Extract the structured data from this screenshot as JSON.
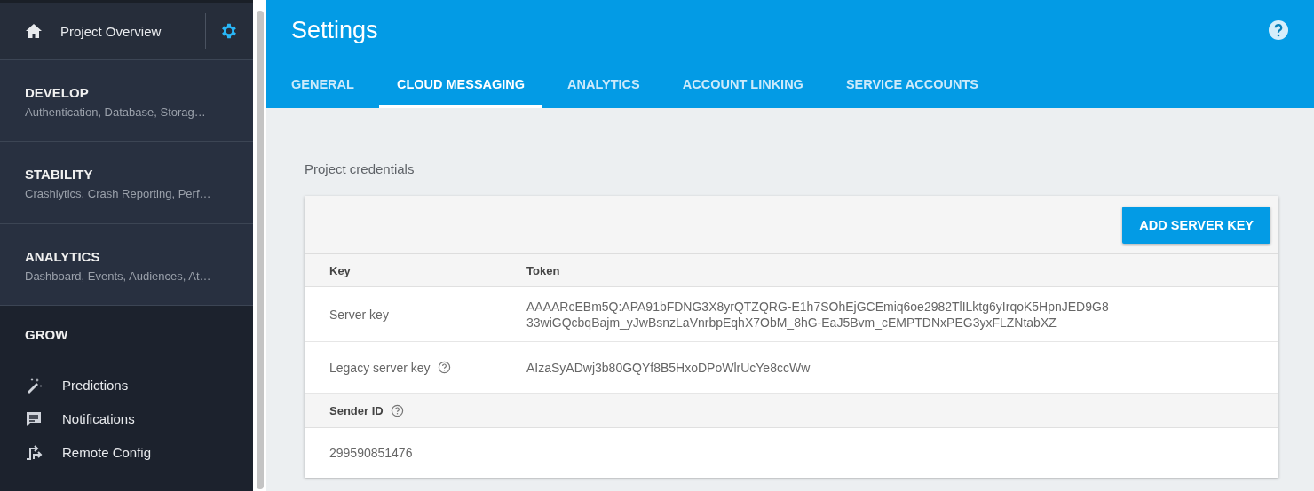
{
  "sidebar": {
    "overview": {
      "label": "Project Overview"
    },
    "sections": [
      {
        "title": "DEVELOP",
        "subtitle": "Authentication, Database, Storag…"
      },
      {
        "title": "STABILITY",
        "subtitle": "Crashlytics, Crash Reporting, Perf…"
      },
      {
        "title": "ANALYTICS",
        "subtitle": "Dashboard, Events, Audiences, At…"
      }
    ],
    "grow": {
      "title": "GROW",
      "items": [
        {
          "label": "Predictions",
          "kind": "wand"
        },
        {
          "label": "Notifications",
          "kind": "message"
        },
        {
          "label": "Remote Config",
          "kind": "config"
        }
      ]
    }
  },
  "header": {
    "title": "Settings",
    "tabs": [
      {
        "label": "GENERAL",
        "selected": false
      },
      {
        "label": "CLOUD MESSAGING",
        "selected": true
      },
      {
        "label": "ANALYTICS",
        "selected": false
      },
      {
        "label": "ACCOUNT LINKING",
        "selected": false
      },
      {
        "label": "SERVICE ACCOUNTS",
        "selected": false
      }
    ]
  },
  "credentials": {
    "heading": "Project credentials",
    "button": "ADD SERVER KEY",
    "columns": [
      "Key",
      "Token"
    ],
    "rows": [
      {
        "key": "Server key",
        "help": false,
        "token": "AAAARcEBm5Q:APA91bFDNG3X8yrQTZQRG-E1h7SOhEjGCEmiq6oe2982TlILktg6yIrqoK5HpnJED9G8 33wiGQcbqBajm_yJwBsnzLaVnrbpEqhX7ObM_8hG-EaJ5Bvm_cEMPTDNxPEG3yxFLZNtabXZ"
      },
      {
        "key": "Legacy server key",
        "help": true,
        "token": "AIzaSyADwj3b80GQYf8B5HxoDPoWlrUcYe8ccWw"
      }
    ],
    "sender": {
      "label": "Sender ID",
      "help": true,
      "value": "299590851476"
    }
  }
}
